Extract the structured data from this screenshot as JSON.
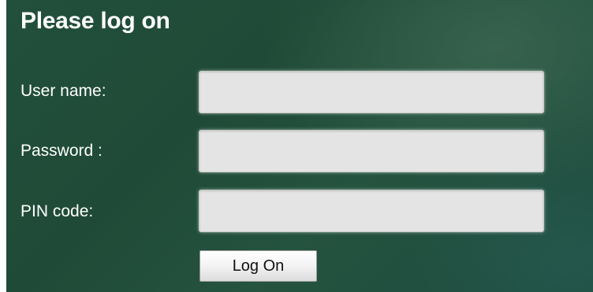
{
  "login": {
    "title": "Please log on",
    "fields": [
      {
        "label": "User name:",
        "value": "",
        "placeholder": ""
      },
      {
        "label": "Password :",
        "value": "",
        "placeholder": ""
      },
      {
        "label": "PIN code:",
        "value": "",
        "placeholder": ""
      }
    ],
    "submit_label": "Log On"
  }
}
